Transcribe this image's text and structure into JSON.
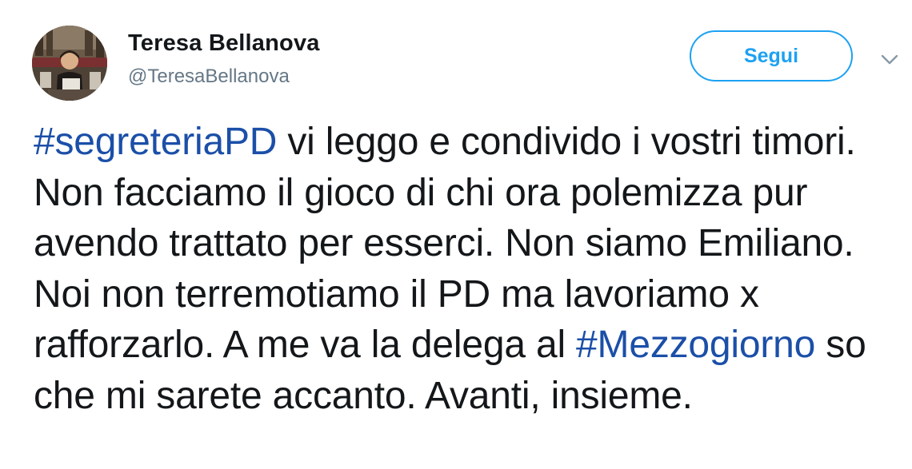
{
  "author": {
    "name": "Teresa Bellanova",
    "handle": "@TeresaBellanova",
    "avatar_icon": "profile-photo"
  },
  "actions": {
    "follow_label": "Segui",
    "more_icon": "chevron-down-icon"
  },
  "tweet": {
    "segments": [
      {
        "type": "hashtag",
        "text": "#segreteriaPD"
      },
      {
        "type": "text",
        "text": " vi leggo e condivido i vostri timori. Non facciamo il gioco di chi ora polemizza pur avendo trattato per esserci. Non siamo Emiliano. Noi non terremotiamo il PD ma lavoriamo x rafforzarlo. A me va la delega al "
      },
      {
        "type": "hashtag",
        "text": "#Mezzogiorno"
      },
      {
        "type": "text",
        "text": " so che mi sarete accanto. Avanti, insieme."
      }
    ]
  },
  "colors": {
    "accent": "#1da1f2",
    "hashtag": "#1b4fa8",
    "text": "#14171a",
    "secondary_text": "#657786"
  }
}
